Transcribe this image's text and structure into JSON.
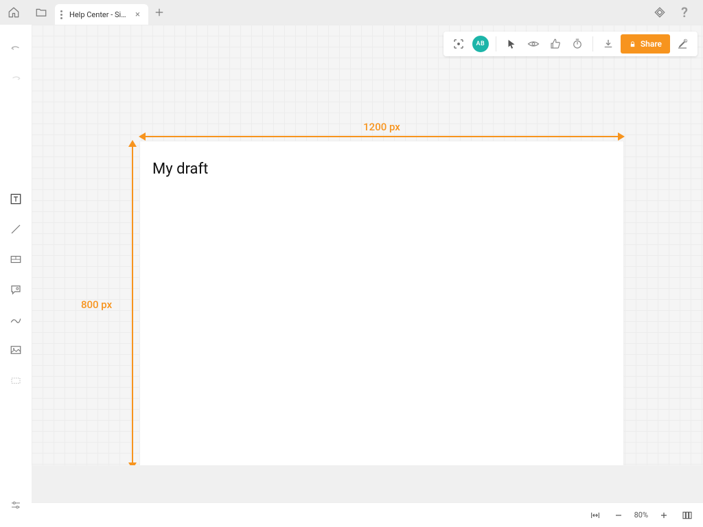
{
  "tab": {
    "title": "Help Center - Size..."
  },
  "canvas": {
    "title": "My draft",
    "width_label": "1200 px",
    "height_label": "800 px"
  },
  "toolbar": {
    "avatar_initials": "AB",
    "share_label": "Share"
  },
  "status": {
    "zoom": "80%"
  },
  "icons": {
    "home": "home-icon",
    "folder": "folder-icon",
    "diamond": "diamond-icon",
    "help": "help-icon",
    "undo": "undo-icon",
    "redo": "redo-icon",
    "text_tool": "text-tool-icon",
    "line_tool": "line-tool-icon",
    "form_tool": "form-tool-icon",
    "comment_tool": "comment-tool-icon",
    "draw_tool": "draw-tool-icon",
    "image_tool": "image-tool-icon",
    "lasso_tool": "lasso-tool-icon",
    "settings": "settings-icon",
    "focus": "focus-icon",
    "cursor": "cursor-icon",
    "eye": "eye-icon",
    "thumbs": "thumbs-icon",
    "timer": "timer-icon",
    "download": "download-icon",
    "pen_edit": "pen-edit-icon",
    "fit": "fit-width-icon",
    "minus": "minus-icon",
    "plus": "plus-icon",
    "pages": "pages-icon"
  }
}
